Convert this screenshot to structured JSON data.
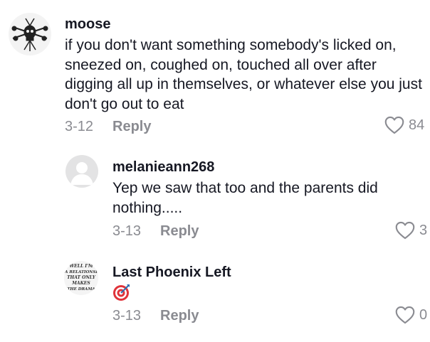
{
  "comments": [
    {
      "username": "moose",
      "text": "if you don't want something somebody's licked on, sneezed on, coughed on, touched all over after digging all up in themselves, or whatever else you just don't go out to eat",
      "date": "3-12",
      "reply_label": "Reply",
      "likes": "84",
      "avatar_icon": "skull-art-avatar"
    }
  ],
  "replies": [
    {
      "username": "melanieann268",
      "text": "Yep we saw that too and the parents did nothing.....",
      "date": "3-13",
      "reply_label": "Reply",
      "likes": "3",
      "avatar_icon": "default-user-avatar"
    },
    {
      "username": "Last Phoenix Left",
      "text_icon": "direct-hit-target-emoji",
      "date": "3-13",
      "reply_label": "Reply",
      "likes": "0",
      "avatar_icon": "text-art-avatar",
      "avatar_text": "WELL I'M IN A RELATIONSHIP THAT ONLY MAKES THE DRAMA"
    }
  ],
  "colors": {
    "text_primary": "#161823",
    "text_secondary": "#8a8b91",
    "target_red": "#e0333a"
  }
}
